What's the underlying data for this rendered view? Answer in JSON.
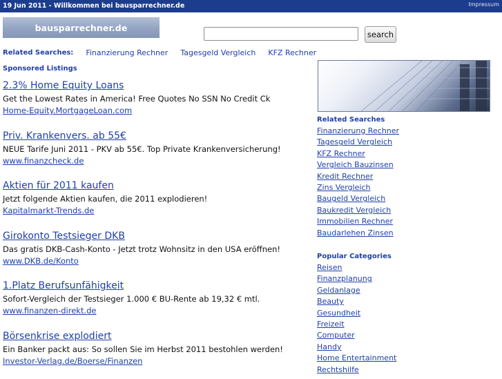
{
  "header": {
    "title": "19 Jun 2011 - Willkommen bei bausparrechner.de",
    "impressum": "Impressum"
  },
  "logo": {
    "text": "bausparrechner.de"
  },
  "search": {
    "value": "",
    "placeholder": "",
    "button_label": "search"
  },
  "related_bar": {
    "label": "Related Searches:",
    "items": [
      "Finanzierung Rechner",
      "Tagesgeld Vergleich",
      "KFZ Rechner"
    ]
  },
  "sponsored": {
    "label": "Sponsored Listings",
    "listings": [
      {
        "title": "2.3% Home Equity Loans",
        "description": "Get the Lowest Rates in America! Free Quotes No SSN No Credit Ck",
        "url": "Home-Equity.MortgageLoan.com"
      },
      {
        "title": "Priv. Krankenvers. ab 55€",
        "description": "NEUE Tarife Juni 2011 - PKV ab 55€. Top Private Krankenversicherung!",
        "url": "www.finanzcheck.de"
      },
      {
        "title": "Aktien für 2011 kaufen",
        "description": "Jetzt folgende Aktien kaufen, die 2011 explodieren!",
        "url": "Kapitalmarkt-Trends.de"
      },
      {
        "title": "Girokonto Testsieger DKB",
        "description": "Das gratis DKB-Cash-Konto - Jetzt trotz Wohnsitz in den USA eröffnen!",
        "url": "www.DKB.de/Konto"
      },
      {
        "title": "1.Platz Berufsunfähigkeit",
        "description": "Sofort-Vergleich der Testsieger 1.000 € BU-Rente ab 19,32 € mtl.",
        "url": "www.finanzen-direkt.de"
      },
      {
        "title": "Börsenkrise explodiert",
        "description": "Ein Banker packt aus: So sollen Sie im Herbst 2011 bestohlen werden!",
        "url": "Investor-Verlag.de/Boerse/Finanzen"
      }
    ]
  },
  "sidebar": {
    "related_title": "Related Searches",
    "related": [
      "Finanzierung Rechner",
      "Tagesgeld Vergleich",
      "KFZ Rechner",
      "Vergleich Bauzinsen",
      "Kredit Rechner",
      "Zins Vergleich",
      "Baugeld Vergleich",
      "Baukredit Vergleich",
      "Immobilien Rechner",
      "Baudarlehen Zinsen"
    ],
    "categories_title": "Popular Categories",
    "categories": [
      "Reisen",
      "Finanzplanung",
      "Geldanlage",
      "Beauty",
      "Gesundheit",
      "Freizeit",
      "Computer",
      "Handy",
      "Home Entertainment",
      "Rechtshilfe"
    ]
  },
  "colors": {
    "top_bar": "#1c3d8e",
    "link": "#1d3fa8"
  }
}
